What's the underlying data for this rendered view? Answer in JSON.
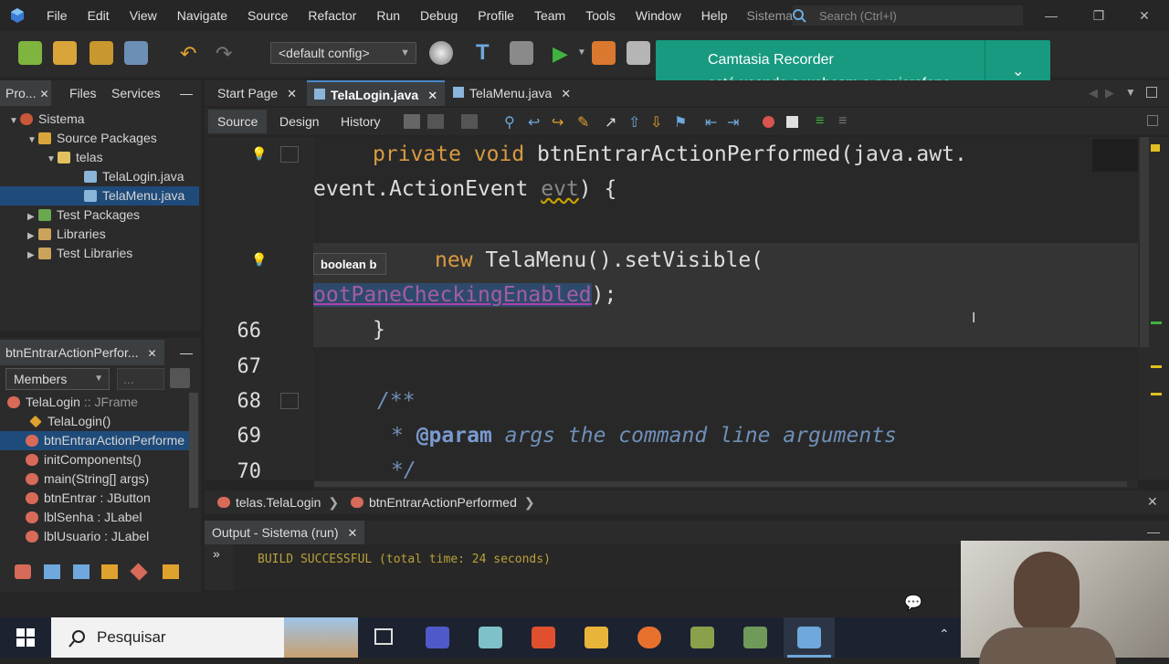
{
  "menubar": {
    "items": [
      "File",
      "Edit",
      "View",
      "Navigate",
      "Source",
      "Refactor",
      "Run",
      "Debug",
      "Profile",
      "Team",
      "Tools",
      "Window",
      "Help"
    ],
    "title": "Sistema - A...",
    "search_placeholder": "Search (Ctrl+I)"
  },
  "toolbar": {
    "config": "<default config>"
  },
  "notification": {
    "line1": "Camtasia Recorder",
    "line2": "está usando a webcam e o microfone"
  },
  "project_panel": {
    "tabs": [
      "Pro...",
      "Files",
      "Services"
    ],
    "tree": {
      "root": "Sistema",
      "source_packages": "Source Packages",
      "package": "telas",
      "file1": "TelaLogin.java",
      "file2": "TelaMenu.java",
      "test_packages": "Test Packages",
      "libraries": "Libraries",
      "test_libraries": "Test Libraries"
    }
  },
  "navigator": {
    "title": "btnEntrarActionPerfor...",
    "members_label": "Members",
    "class_name": "TelaLogin",
    "class_type": ":: JFrame",
    "items": [
      {
        "name": "TelaLogin()",
        "type": ""
      },
      {
        "name": "btnEntrarActionPerforme",
        "type": ""
      },
      {
        "name": "initComponents()",
        "type": ""
      },
      {
        "name": "main(String[] args)",
        "type": ""
      },
      {
        "name": "btnEntrar",
        "type": ": JButton"
      },
      {
        "name": "lblSenha",
        "type": ": JLabel"
      },
      {
        "name": "lblUsuario",
        "type": ": JLabel"
      }
    ]
  },
  "editor_tabs": [
    "Start Page",
    "TelaLogin.java",
    "TelaMenu.java"
  ],
  "source_tabs": {
    "source": "Source",
    "design": "Design",
    "history": "History"
  },
  "code": {
    "line1_kw": "private void",
    "line1_rest": " btnEntrarActionPerformed(java.awt.",
    "line2_a": "event.ActionEvent ",
    "line2_param": "evt",
    "line2_b": ") {",
    "line3_kw": "new",
    "line3_rest": " TelaMenu().setVisible(",
    "line4_hl": "ootPaneCheckingEnabled",
    "line4_rest": ");",
    "line66": "}",
    "line68": "/**",
    "line69_star": "* ",
    "line69_tag": "@param",
    "line69_rest": " args the command line arguments",
    "line70": "*/",
    "tooltip": "boolean b",
    "line_numbers": [
      "66",
      "67",
      "68",
      "69",
      "70"
    ]
  },
  "breadcrumb": {
    "package": "telas.TelaLogin",
    "method": "btnEntrarActionPerformed"
  },
  "output": {
    "tab": "Output - Sistema (run)",
    "text": "BUILD SUCCESSFUL (total time: 24 seconds)"
  },
  "taskbar": {
    "search_text": "Pesquisar"
  },
  "colors": {
    "notification": "#179a80",
    "keyword": "#d99a3e",
    "selection": "#1f4b7a",
    "build_text": "#b9a13a"
  }
}
